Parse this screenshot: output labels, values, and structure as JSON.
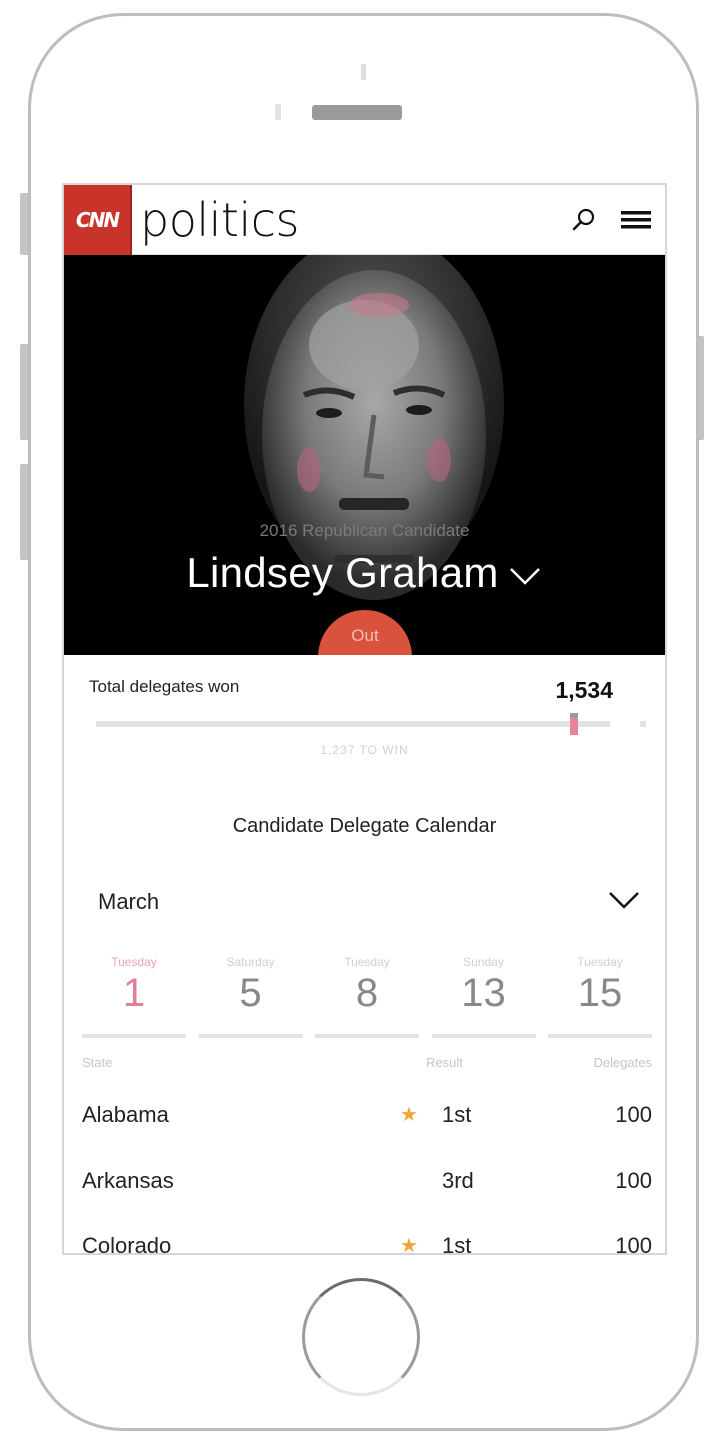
{
  "app": {
    "brand_logo": "CNN",
    "section_title": "politics",
    "icons": {
      "search": "search-icon",
      "menu": "hamburger-menu-icon"
    }
  },
  "hero": {
    "subtitle": "2016 Republican Candidate",
    "candidate_name": "Lindsey Graham",
    "status_badge": "Out",
    "colors": {
      "badge": "#d9533c",
      "background": "#000000"
    }
  },
  "delegates": {
    "label": "Total delegates won",
    "value": "1,534",
    "progress_fraction": 0.93,
    "note": "1,237 TO WIN",
    "colors": {
      "marker": "#e8839a",
      "track": "#e2e2e2"
    }
  },
  "calendar": {
    "title": "Candidate Delegate Calendar",
    "selected_month": "March",
    "dates": [
      {
        "day": "Tuesday",
        "num": "1",
        "active": true
      },
      {
        "day": "Saturday",
        "num": "5",
        "active": false
      },
      {
        "day": "Tuesday",
        "num": "8",
        "active": false
      },
      {
        "day": "Sunday",
        "num": "13",
        "active": false
      },
      {
        "day": "Tuesday",
        "num": "15",
        "active": false
      }
    ]
  },
  "results_table": {
    "columns": [
      "State",
      "Result",
      "Delegates"
    ],
    "rows": [
      {
        "state": "Alabama",
        "winner_star": true,
        "result": "1st",
        "delegates": "100"
      },
      {
        "state": "Arkansas",
        "winner_star": false,
        "result": "3rd",
        "delegates": "100"
      },
      {
        "state": "Colorado",
        "winner_star": true,
        "result": "1st",
        "delegates": "100"
      }
    ],
    "star_icon": "★",
    "colors": {
      "star": "#f2a33a"
    }
  }
}
